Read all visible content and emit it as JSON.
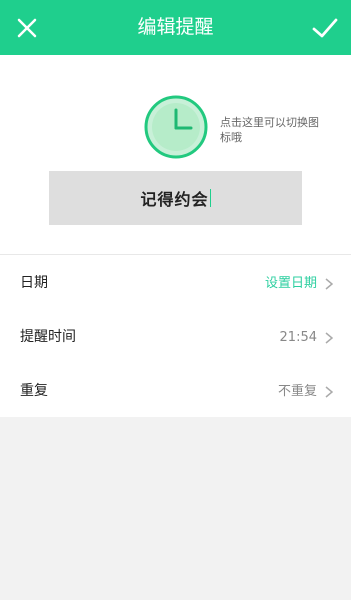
{
  "header": {
    "title": "编辑提醒",
    "close_icon": "close-icon",
    "confirm_icon": "check-icon"
  },
  "icon_picker": {
    "icon": "clock-icon",
    "hint": "点击这里可以切换图标哦"
  },
  "reminder": {
    "title_value": "记得约会"
  },
  "rows": [
    {
      "label": "日期",
      "value": "设置日期",
      "accent": true
    },
    {
      "label": "提醒时间",
      "value": "21:54",
      "accent": false
    },
    {
      "label": "重复",
      "value": "不重复",
      "accent": false
    }
  ],
  "colors": {
    "brand": "#1fcf8d",
    "accent_text": "#2dcfa0",
    "clock_fill": "#c8f0d8",
    "clock_stroke": "#22c97f"
  }
}
